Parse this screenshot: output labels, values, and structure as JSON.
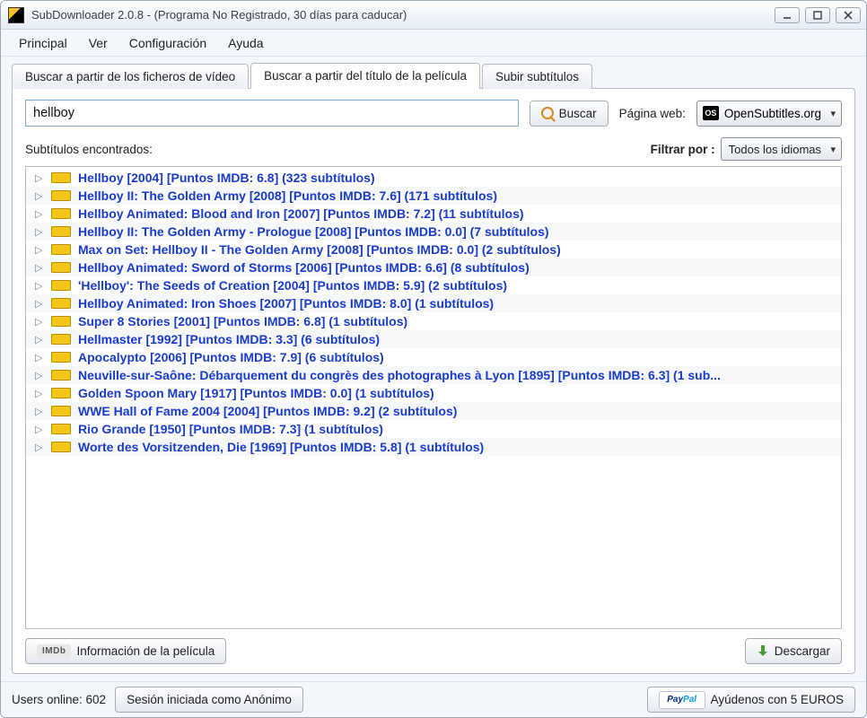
{
  "window_title": "SubDownloader 2.0.8 - (Programa No Registrado, 30 días para caducar)",
  "menu": {
    "principal": "Principal",
    "ver": "Ver",
    "configuracion": "Configuración",
    "ayuda": "Ayuda"
  },
  "tabs": {
    "a": "Buscar a partir de los ficheros de vídeo",
    "b": "Buscar a partir del título de la película",
    "c": "Subir subtítulos"
  },
  "search": {
    "value": "hellboy",
    "button": "Buscar",
    "site_label": "Página web:",
    "site_value": "OpenSubtitles.org"
  },
  "results_header": {
    "found": "Subtítulos encontrados:",
    "filter_label": "Filtrar por :",
    "filter_value": "Todos los idiomas"
  },
  "results": [
    "Hellboy [2004]  [Puntos IMDB: 6.8]  (323 subtítulos)",
    "Hellboy II: The Golden Army [2008]  [Puntos IMDB: 7.6]  (171 subtítulos)",
    "Hellboy Animated: Blood and Iron [2007]  [Puntos IMDB: 7.2]  (11 subtítulos)",
    "Hellboy II: The Golden Army - Prologue [2008]  [Puntos IMDB: 0.0]  (7 subtítulos)",
    "Max on Set: Hellboy II - The Golden Army [2008]  [Puntos IMDB: 0.0]  (2 subtítulos)",
    "Hellboy Animated: Sword of Storms [2006]  [Puntos IMDB: 6.6]  (8 subtítulos)",
    "'Hellboy': The Seeds of Creation [2004]  [Puntos IMDB: 5.9]  (2 subtítulos)",
    "Hellboy Animated: Iron Shoes [2007]  [Puntos IMDB: 8.0]  (1 subtítulos)",
    " Super 8 Stories [2001]  [Puntos IMDB: 6.8]  (1 subtítulos)",
    "Hellmaster [1992]  [Puntos IMDB: 3.3]  (6 subtítulos)",
    "Apocalypto [2006]  [Puntos IMDB: 7.9]  (6 subtítulos)",
    "Neuville-sur-Saône: Débarquement du congrès des photographes à Lyon [1895]  [Puntos IMDB: 6.3]  (1 sub...",
    "Golden Spoon Mary [1917]  [Puntos IMDB: 0.0]  (1 subtítulos)",
    "WWE Hall of Fame 2004 [2004]  [Puntos IMDB: 9.2]  (2 subtítulos)",
    "Rio Grande [1950]  [Puntos IMDB: 7.3]  (1 subtítulos)",
    "Worte des Vorsitzenden, Die [1969]  [Puntos IMDB: 5.8]  (1 subtítulos)"
  ],
  "panel_bottom": {
    "info_button": "Información de la película",
    "download_button": "Descargar"
  },
  "status": {
    "users_online": "Users online: 602",
    "session": "Sesión iniciada como Anónimo",
    "help_us": "Ayúdenos con 5 EUROS"
  }
}
